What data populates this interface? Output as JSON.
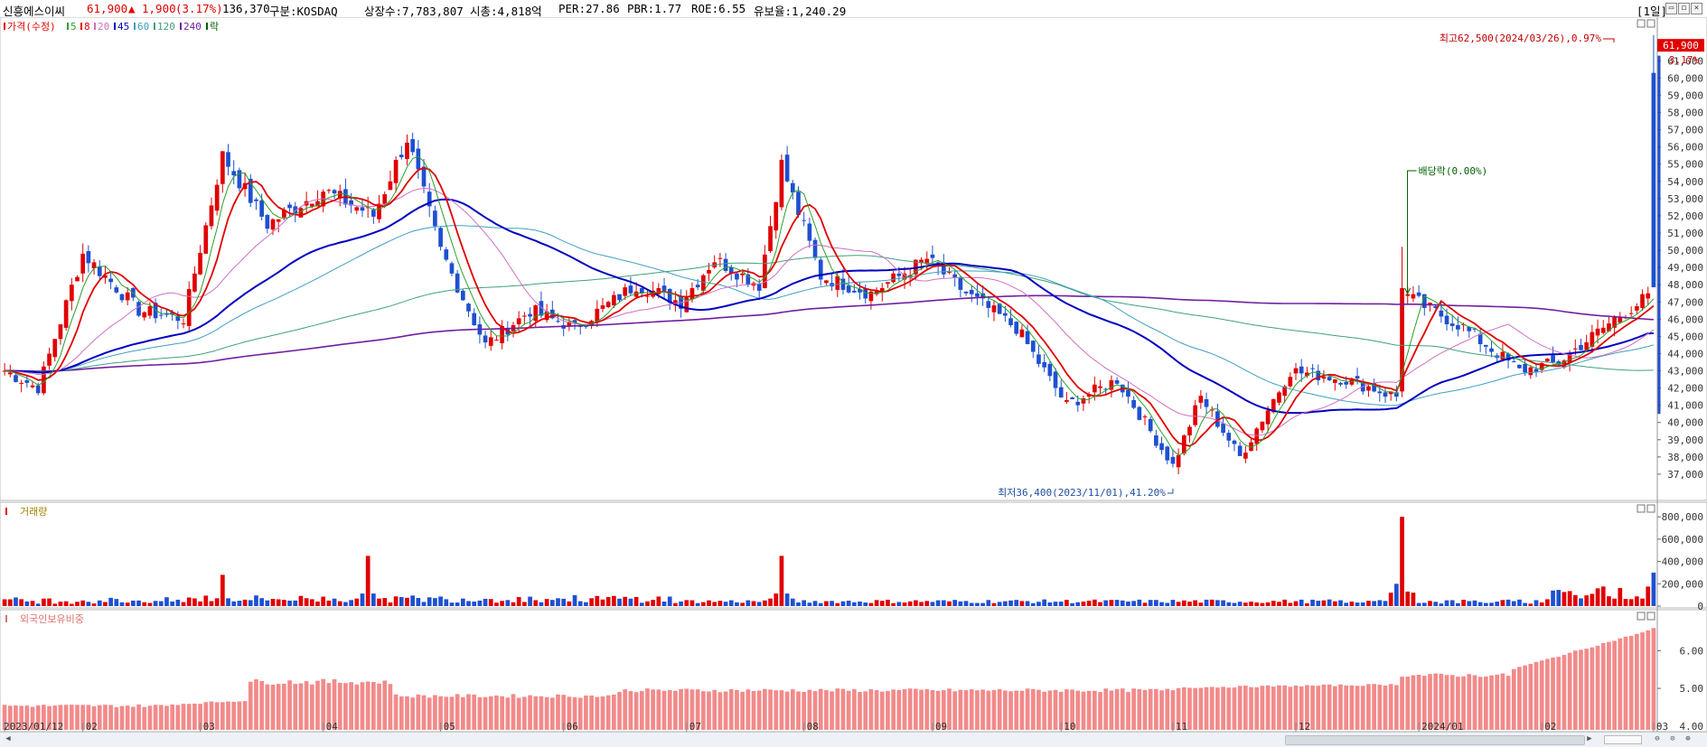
{
  "header": {
    "stock_name": "신흥에스이씨",
    "price": "61,900",
    "change_arrow": "▲",
    "change": "1,900",
    "change_pct": "(3.17%)",
    "volume": "136,370",
    "market": "구분:KOSDAQ",
    "shares": "상장수:7,783,807",
    "market_cap": "시총:4,818억",
    "per": "PER:27.86",
    "pbr": "PBR:1.77",
    "roe": "ROE:6.55",
    "float_ratio": "유보율:1,240.29",
    "period": "[1일]"
  },
  "price_panel": {
    "legend": [
      {
        "label": "가격(수정)",
        "color": "#e00000"
      },
      {
        "label": "5",
        "color": "#2ca02c"
      },
      {
        "label": "8",
        "color": "#e00000"
      },
      {
        "label": "20",
        "color": "#d070c0"
      },
      {
        "label": "45",
        "color": "#0000c0"
      },
      {
        "label": "60",
        "color": "#40a0c0"
      },
      {
        "label": "120",
        "color": "#40a080"
      },
      {
        "label": "240",
        "color": "#7020a0"
      },
      {
        "label": "락",
        "color": "#006000"
      }
    ],
    "high_annotation": "최고62,500(2024/03/26),0.97%",
    "low_annotation": "최저36,400(2023/11/01),41.20%",
    "dividend_annotation": "배당락(0.00%)",
    "current_price_tag": "61,900",
    "current_pct_tag": "3.17%"
  },
  "volume_panel": {
    "title": "거래량"
  },
  "foreign_panel": {
    "title": "외국인보유비중"
  },
  "axes": {
    "x_labels": [
      "2023/01/12",
      "02",
      "03",
      "04",
      "05",
      "06",
      "07",
      "08",
      "09",
      "10",
      "11",
      "12",
      "2024/01",
      "02",
      "03"
    ],
    "price_ticks": [
      "61,000",
      "60,000",
      "59,000",
      "58,000",
      "57,000",
      "56,000",
      "55,000",
      "54,000",
      "53,000",
      "52,000",
      "51,000",
      "50,000",
      "49,000",
      "48,000",
      "47,000",
      "46,000",
      "45,000",
      "44,000",
      "43,000",
      "42,000",
      "41,000",
      "40,000",
      "39,000",
      "38,000",
      "37,000"
    ],
    "volume_ticks": [
      "800,000",
      "600,000",
      "400,000",
      "200,000",
      "0"
    ],
    "foreign_ticks": [
      "6.00",
      "5.00",
      "4.00"
    ]
  },
  "colors": {
    "up": "#e00000",
    "down": "#1e50d0",
    "foreign_bar": "#f28a8a",
    "background": "#ffffff"
  },
  "chart_data": {
    "type": "candlestick",
    "period": "daily",
    "start_date": "2023/01/12",
    "end_date": "2024/03/26",
    "price_range": [
      36400,
      62500
    ],
    "anchors": [
      {
        "date": "2023/01/12",
        "close": 43000
      },
      {
        "date": "2023/01/20",
        "close": 42000
      },
      {
        "date": "2023/02/01",
        "close": 49800
      },
      {
        "date": "2023/02/15",
        "close": 46500
      },
      {
        "date": "2023/02/27",
        "close": 46000
      },
      {
        "date": "2023/03/08",
        "close": 55500
      },
      {
        "date": "2023/03/20",
        "close": 51500
      },
      {
        "date": "2023/04/03",
        "close": 53500
      },
      {
        "date": "2023/04/14",
        "close": 52000
      },
      {
        "date": "2023/04/24",
        "close": 56500
      },
      {
        "date": "2023/05/02",
        "close": 50000
      },
      {
        "date": "2023/05/12",
        "close": 44500
      },
      {
        "date": "2023/05/24",
        "close": 46500
      },
      {
        "date": "2023/06/05",
        "close": 45500
      },
      {
        "date": "2023/06/20",
        "close": 48000
      },
      {
        "date": "2023/06/30",
        "close": 47000
      },
      {
        "date": "2023/07/10",
        "close": 49500
      },
      {
        "date": "2023/07/20",
        "close": 48000
      },
      {
        "date": "2023/07/26",
        "close": 55000
      },
      {
        "date": "2023/08/04",
        "close": 48500
      },
      {
        "date": "2023/08/17",
        "close": 47500
      },
      {
        "date": "2023/08/31",
        "close": 49500
      },
      {
        "date": "2023/09/11",
        "close": 47500
      },
      {
        "date": "2023/09/22",
        "close": 45500
      },
      {
        "date": "2023/10/05",
        "close": 41000
      },
      {
        "date": "2023/10/18",
        "close": 42500
      },
      {
        "date": "2023/11/01",
        "close": 37500
      },
      {
        "date": "2023/11/08",
        "close": 41500
      },
      {
        "date": "2023/11/17",
        "close": 38000
      },
      {
        "date": "2023/11/30",
        "close": 43000
      },
      {
        "date": "2023/12/14",
        "close": 42500
      },
      {
        "date": "2023/12/27",
        "close": 41500
      },
      {
        "date": "2023/12/28",
        "close": 47500
      },
      {
        "date": "2024/01/12",
        "close": 45500
      },
      {
        "date": "2024/01/26",
        "close": 43000
      },
      {
        "date": "2024/02/06",
        "close": 43500
      },
      {
        "date": "2024/02/20",
        "close": 46000
      },
      {
        "date": "2024/03/04",
        "close": 47500
      },
      {
        "date": "2024/03/12",
        "close": 51500
      },
      {
        "date": "2024/03/20",
        "close": 56000
      },
      {
        "date": "2024/03/26",
        "close": 61900
      }
    ],
    "volume_spikes": [
      {
        "date": "2023/03/08",
        "volume": 280000
      },
      {
        "date": "2023/04/13",
        "volume": 450000
      },
      {
        "date": "2023/07/26",
        "volume": 450000
      },
      {
        "date": "2023/12/28",
        "volume": 800000
      },
      {
        "date": "2024/03/13",
        "volume": 320000
      },
      {
        "date": "2024/03/22",
        "volume": 300000
      }
    ],
    "foreign_ownership_range": [
      4.0,
      6.6
    ],
    "moving_averages": [
      "5",
      "8",
      "20",
      "45",
      "60",
      "120",
      "240"
    ]
  }
}
